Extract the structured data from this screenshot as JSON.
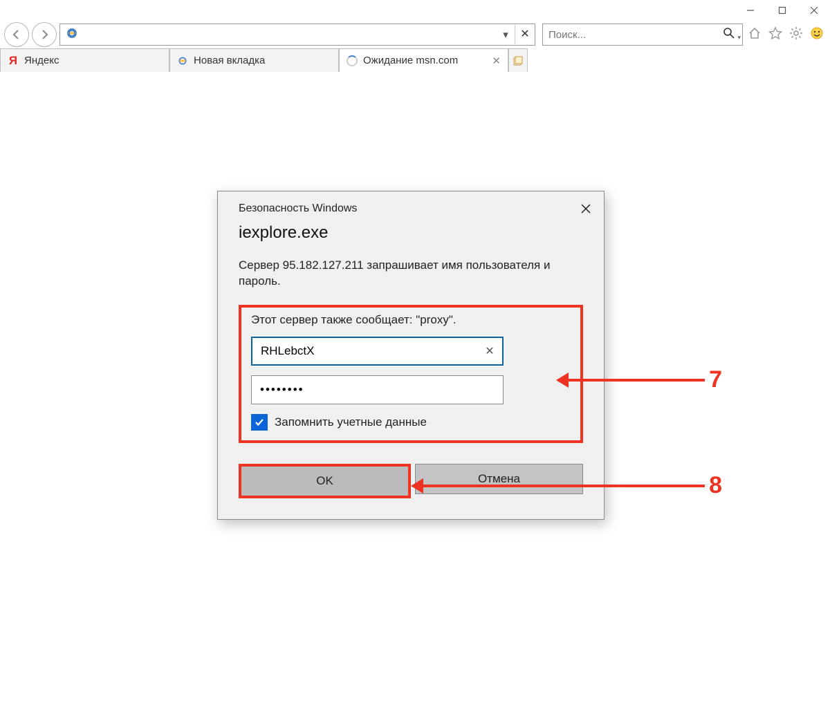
{
  "window_controls": {
    "minimize": "min",
    "maximize": "max",
    "close": "close"
  },
  "address_bar": {
    "url": "",
    "search_placeholder": "Поиск..."
  },
  "tabs": [
    {
      "label": "Яндекс",
      "favicon": "yandex"
    },
    {
      "label": "Новая вкладка",
      "favicon": "ie"
    },
    {
      "label": "Ожидание msn.com",
      "favicon": "loading"
    }
  ],
  "dialog": {
    "title": "Безопасность Windows",
    "subtitle": "iexplore.exe",
    "message": "Сервер 95.182.127.211 запрашивает имя пользователя и пароль.",
    "realm": "Этот сервер также сообщает: \"proxy\".",
    "username": "RHLebctX",
    "password": "••••••••",
    "remember_label": "Запомнить учетные данные",
    "remember_checked": true,
    "ok_label": "OK",
    "cancel_label": "Отмена"
  },
  "annotations": {
    "step7": "7",
    "step8": "8"
  }
}
